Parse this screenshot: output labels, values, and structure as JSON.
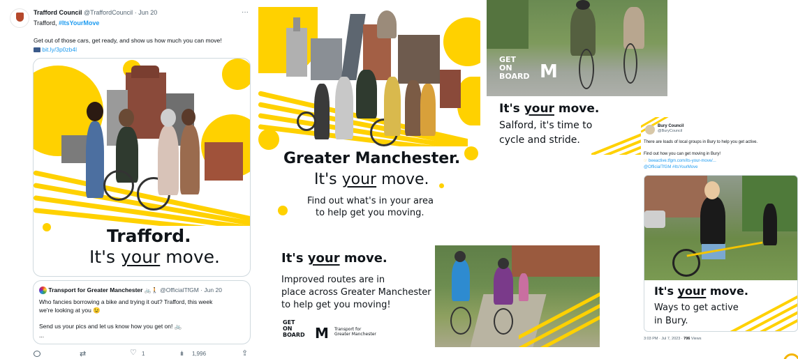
{
  "tweet1": {
    "author": "Trafford Council",
    "handle": "@TraffordCouncil",
    "date": "· Jun 20",
    "line1_prefix": "Trafford,",
    "hashtag": "#ItsYourMove",
    "body": "Get out of those cars, get ready, and show us how much you can move!",
    "link": "bit.ly/3p0zb4l",
    "more": "···",
    "image_title": "Trafford.",
    "image_sub_pre": "It's ",
    "image_sub_u": "your",
    "image_sub_post": " move.",
    "quote": {
      "author": "Transport for Greater Manchester",
      "emojis": "🚲🚶",
      "handle": "@OfficialTfGM",
      "date": "· Jun 20",
      "line1": "Who fancies borrowing a bike and trying it out? Trafford, this week",
      "line2": "we're looking at you 😉",
      "line3": "Send us your pics and let us know how you get on! 🚲",
      "ellipsis": "..."
    },
    "actions": {
      "reply": "",
      "retweet": "",
      "likes": "1",
      "views": "1,996"
    }
  },
  "poster_gm": {
    "title": "Greater Manchester.",
    "sub_pre": "It's ",
    "sub_u": "your",
    "sub_post": " move.",
    "line1": "Find out what's in your area",
    "line2": "to help get you moving."
  },
  "poster_routes": {
    "head_pre": "It's ",
    "head_u": "your",
    "head_post": " move.",
    "line1": "Improved routes are in",
    "line2": "place across Greater Manchester",
    "line3": "to help get you moving!",
    "logo_geton": [
      "GET",
      "ON",
      "BOARD"
    ],
    "logo_tfgm_line1": "Transport for",
    "logo_tfgm_line2": "Greater Manchester"
  },
  "poster_salford": {
    "geton": [
      "GET",
      "ON",
      "BOARD"
    ],
    "head_pre": "It's ",
    "head_u": "your",
    "head_post": " move.",
    "line1": "Salford, it's time to",
    "line2": "cycle and stride."
  },
  "tweet_bury": {
    "author": "Bury Council",
    "handle": "@BuryCouncil",
    "body": "There are loads of local groups in Bury to help you get active.",
    "line2": "Find out how you can get moving in Bury!",
    "link": "beeactive.tfgm.com/its-your-move/...",
    "tags": "@OfficialTfGM #ItsYourMove",
    "image_head_pre": "It's ",
    "image_head_u": "your",
    "image_head_post": " move.",
    "image_line1": "Ways to get active",
    "image_line2": "in Bury.",
    "meta_time": "3:03 PM · Jul 7, 2023 ·",
    "meta_views": "706",
    "meta_views_label": "Views"
  },
  "colors": {
    "yellow": "#ffd100",
    "link": "#1d9bf0",
    "text": "#0f1419",
    "muted": "#536471"
  }
}
